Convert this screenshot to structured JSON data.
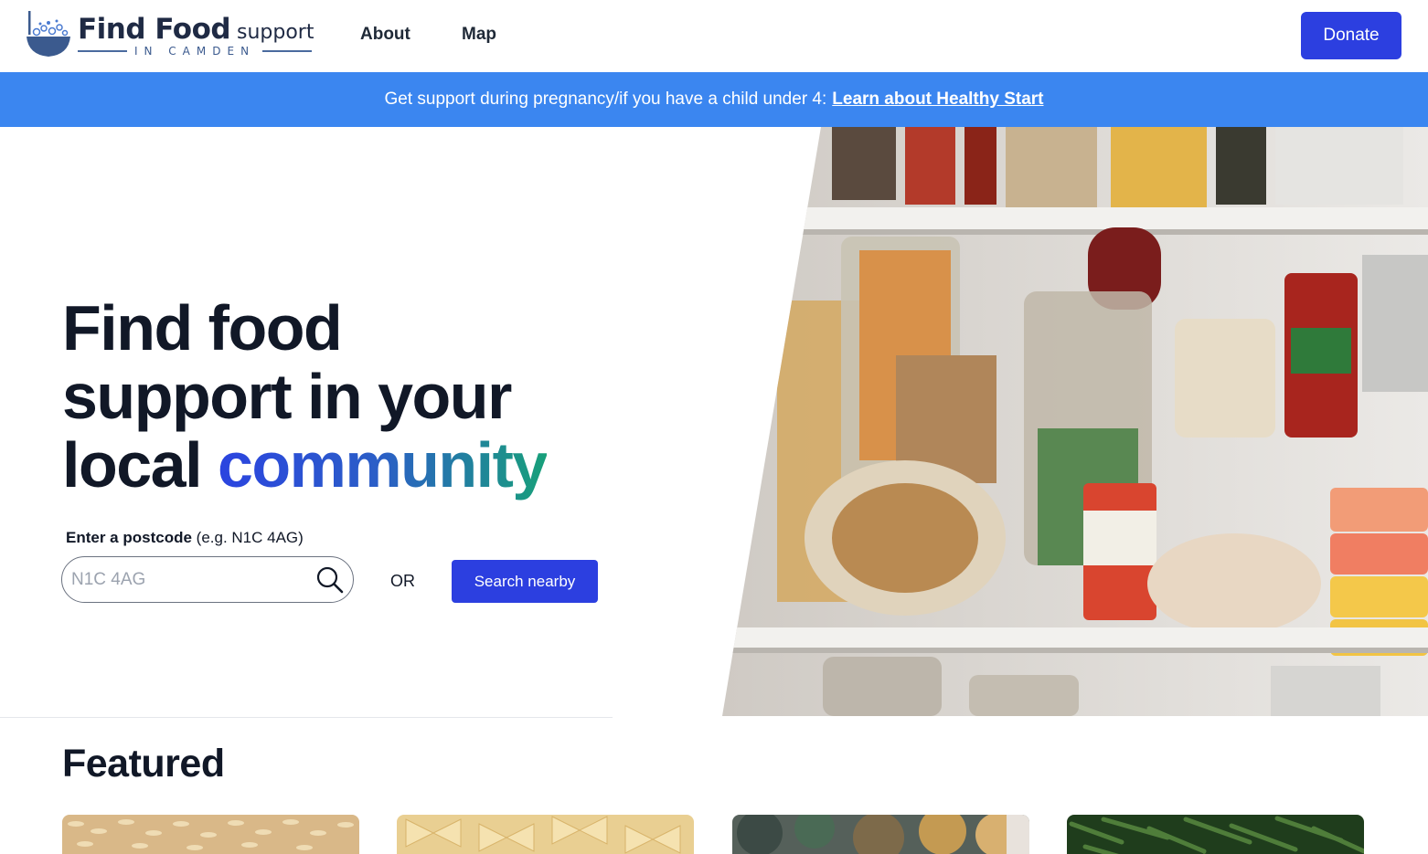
{
  "header": {
    "logo": {
      "title": "Find Food",
      "support": "support",
      "subtitle": "IN CAMDEN"
    },
    "nav": [
      {
        "label": "About"
      },
      {
        "label": "Map"
      }
    ],
    "donate_label": "Donate"
  },
  "banner": {
    "text": "Get support during pregnancy/if you have a child under 4:",
    "link_label": "Learn about Healthy Start",
    "background_color": "#3b86f0"
  },
  "hero": {
    "title_line1": "Find food",
    "title_line2": "support in your",
    "title_line3_plain": "local",
    "title_line3_accent": "community",
    "postcode_label_bold": "Enter a postcode",
    "postcode_label_hint": "(e.g. N1C 4AG)",
    "search_placeholder": "N1C 4AG",
    "search_value": "",
    "or_text": "OR",
    "nearby_label": "Search nearby",
    "image_subject": "pantry-shelves-photo",
    "accent_color": "#2c3fe0"
  },
  "featured": {
    "title": "Featured",
    "cards": [
      {
        "image_subject": "rice-photo"
      },
      {
        "image_subject": "pasta-photo"
      },
      {
        "image_subject": "autumn-trees-photo"
      },
      {
        "image_subject": "green-beans-photo"
      }
    ]
  }
}
